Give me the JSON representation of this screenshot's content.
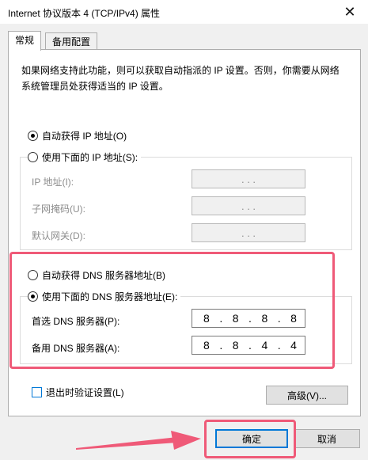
{
  "window": {
    "title": "Internet 协议版本 4 (TCP/IPv4) 属性",
    "close_glyph": "✕"
  },
  "tabs": [
    {
      "label": "常规",
      "active": true
    },
    {
      "label": "备用配置",
      "active": false
    }
  ],
  "description": "如果网络支持此功能，则可以获取自动指派的 IP 设置。否则，你需要从网络系统管理员处获得适当的 IP 设置。",
  "ip_section": {
    "auto_label": "自动获得 IP 地址(O)",
    "manual_label": "使用下面的 IP 地址(S):",
    "fields": [
      {
        "label": "IP 地址(I):",
        "value": ".   .   ."
      },
      {
        "label": "子网掩码(U):",
        "value": ".   .   ."
      },
      {
        "label": "默认网关(D):",
        "value": ".   .   ."
      }
    ]
  },
  "dns_section": {
    "auto_label": "自动获得 DNS 服务器地址(B)",
    "manual_label": "使用下面的 DNS 服务器地址(E):",
    "preferred": {
      "label": "首选 DNS 服务器(P):",
      "octets": [
        "8",
        ".",
        "8",
        ".",
        "8",
        ".",
        "8"
      ]
    },
    "alternate": {
      "label": "备用 DNS 服务器(A):",
      "octets": [
        "8",
        ".",
        "8",
        ".",
        "4",
        ".",
        "4"
      ]
    }
  },
  "validate_label": "退出时验证设置(L)",
  "advanced_label": "高级(V)...",
  "ok_label": "确定",
  "cancel_label": "取消",
  "colors": {
    "highlight": "#ef5a78",
    "focus_border": "#0078d7",
    "checkbox_border": "#0078d7"
  }
}
